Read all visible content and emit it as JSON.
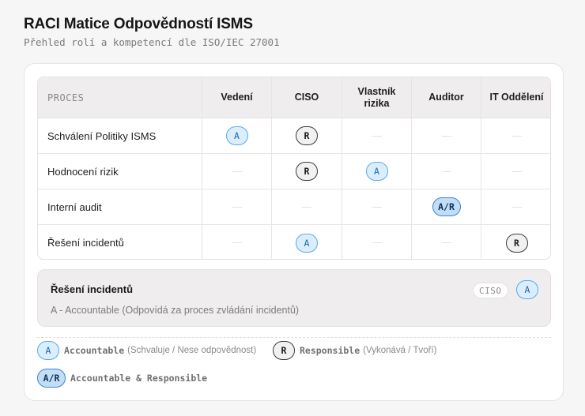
{
  "header": {
    "title": "RACI Matice Odpovědností ISMS",
    "subtitle": "Přehled rolí a kompetencí dle ISO/IEC 27001"
  },
  "table": {
    "columns": [
      "PROCES",
      "Vedení",
      "CISO",
      "Vlastník rizika",
      "Auditor",
      "IT Oddělení"
    ],
    "rows": [
      {
        "process": "Schválení Politiky ISMS",
        "cells": [
          "A",
          "R",
          "",
          "",
          ""
        ]
      },
      {
        "process": "Hodnocení rizik",
        "cells": [
          "",
          "R",
          "A",
          "",
          ""
        ]
      },
      {
        "process": "Interní audit",
        "cells": [
          "",
          "",
          "",
          "A/R",
          ""
        ]
      },
      {
        "process": "Řešení incidentů",
        "cells": [
          "",
          "A",
          "",
          "",
          "R"
        ]
      }
    ]
  },
  "detail": {
    "title": "Řešení incidentů",
    "role": "CISO",
    "badge": "A",
    "description": "A - Accountable (Odpovídá za proces zvládání incidentů)"
  },
  "legend": [
    {
      "badge": "A",
      "name": "Accountable",
      "description": "(Schvaluje / Nese odpovědnost)"
    },
    {
      "badge": "R",
      "name": "Responsible",
      "description": "(Vykonává / Tvoří)"
    },
    {
      "badge": "A/R",
      "name": "Accountable & Responsible",
      "description": ""
    }
  ],
  "colors": {
    "accountable": "#5aa9e6",
    "responsible": "#3a3a3a",
    "accountable_responsible": "#3a86cf"
  }
}
